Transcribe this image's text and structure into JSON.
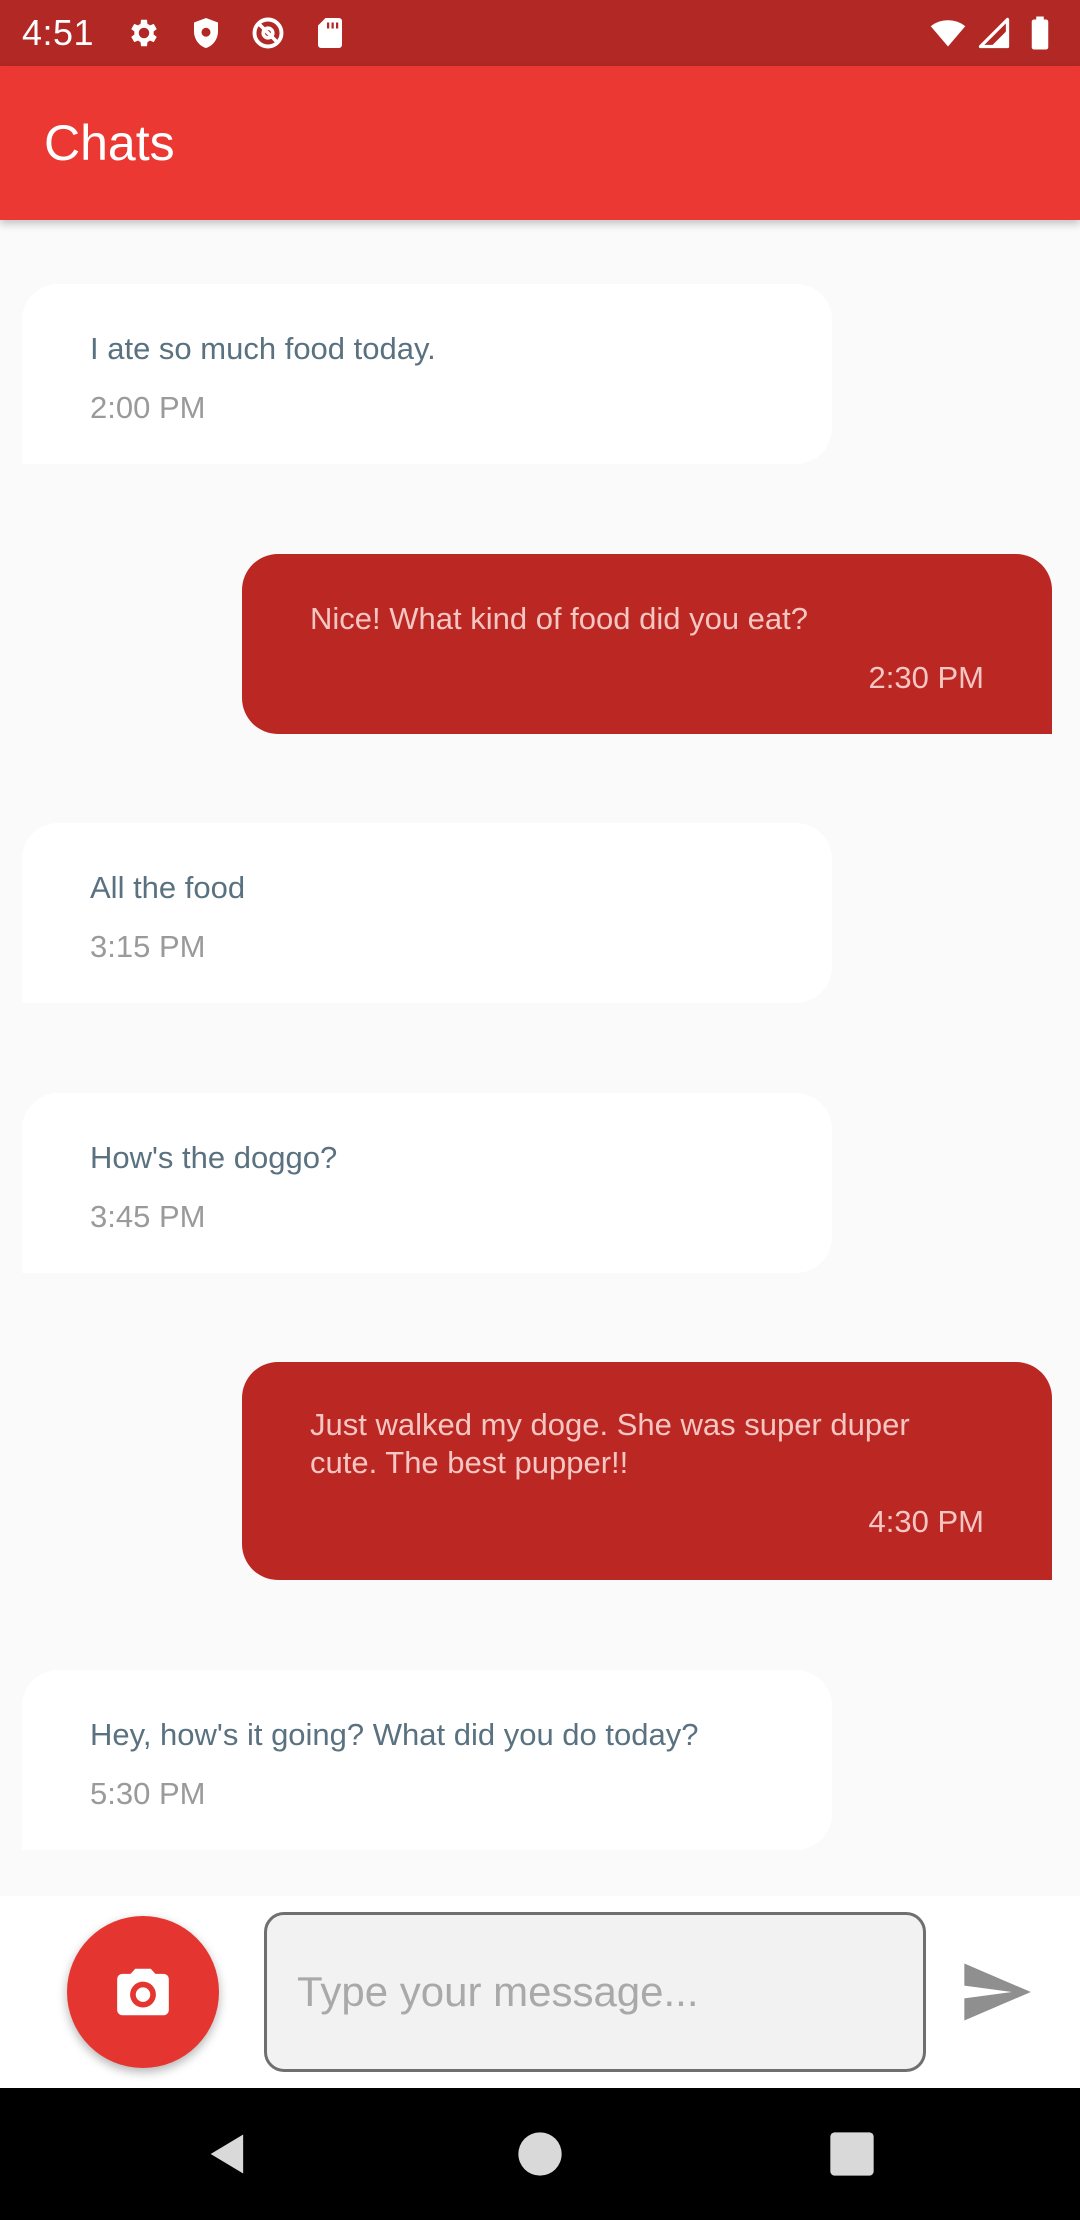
{
  "status_bar": {
    "time": "4:51",
    "left_icons": [
      "gear-icon",
      "shield-icon",
      "at-sign-icon",
      "sd-card-icon"
    ],
    "right_icons": [
      "wifi-icon",
      "signal-icon",
      "battery-icon"
    ]
  },
  "app_bar": {
    "title": "Chats"
  },
  "messages": [
    {
      "direction": "incoming",
      "text": "I ate so much food today.",
      "time": "2:00 PM"
    },
    {
      "direction": "outgoing",
      "text": "Nice! What kind of food did you eat?",
      "time": "2:30 PM"
    },
    {
      "direction": "incoming",
      "text": "All the food",
      "time": "3:15 PM"
    },
    {
      "direction": "incoming",
      "text": "How's the doggo?",
      "time": "3:45 PM"
    },
    {
      "direction": "outgoing",
      "text": "Just walked my doge. She was super duper cute. The best pupper!!",
      "time": "4:30 PM"
    },
    {
      "direction": "incoming",
      "text": "Hey, how's it going? What did you do today?",
      "time": "5:30 PM"
    }
  ],
  "composer": {
    "camera_icon": "camera-icon",
    "input_value": "",
    "input_placeholder": "Type your message...",
    "send_icon": "send-icon"
  },
  "nav_bar": {
    "icons": [
      "back-icon",
      "home-icon",
      "recents-icon"
    ]
  },
  "colors": {
    "status_bar": "#b12824",
    "app_bar": "#ec3832",
    "outgoing_bubble": "#bb2723",
    "incoming_bubble": "#ffffff",
    "camera_button": "#e53530",
    "background": "#fafafa"
  }
}
